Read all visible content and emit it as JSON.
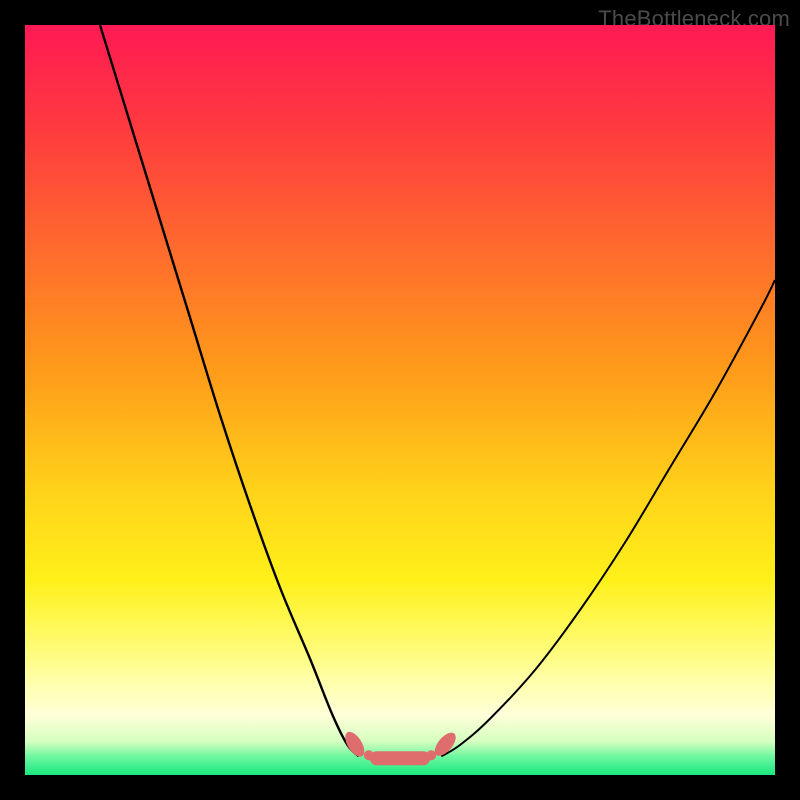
{
  "watermark": "TheBottleneck.com",
  "chart_data": {
    "type": "line",
    "title": "",
    "xlabel": "",
    "ylabel": "",
    "x_range": [
      0,
      100
    ],
    "y_range": [
      0,
      100
    ],
    "grid": false,
    "legend": false,
    "series": [
      {
        "name": "left-curve",
        "x": [
          10,
          14,
          18,
          22,
          26,
          30,
          34,
          38,
          41,
          43,
          44.5
        ],
        "y": [
          100,
          87,
          74,
          61,
          48,
          36,
          25,
          15.5,
          8,
          4,
          2.5
        ]
      },
      {
        "name": "right-curve",
        "x": [
          55.5,
          58,
          62,
          68,
          74,
          80,
          86,
          92,
          98,
          100
        ],
        "y": [
          2.5,
          4,
          7.5,
          14,
          22,
          31,
          41,
          51,
          62,
          66
        ]
      }
    ],
    "flat_segment": {
      "name": "valley-marker",
      "x_start": 44.5,
      "x_end": 55.5,
      "y": 2.5,
      "color": "#e06d6d"
    },
    "gradient_stops": [
      {
        "offset": 0.0,
        "color": "#ff1a54"
      },
      {
        "offset": 0.14,
        "color": "#ff3b3f"
      },
      {
        "offset": 0.3,
        "color": "#ff6b2d"
      },
      {
        "offset": 0.46,
        "color": "#ff9b1a"
      },
      {
        "offset": 0.62,
        "color": "#ffd21a"
      },
      {
        "offset": 0.74,
        "color": "#fff01a"
      },
      {
        "offset": 0.82,
        "color": "#fffb6a"
      },
      {
        "offset": 0.88,
        "color": "#ffffb0"
      },
      {
        "offset": 0.92,
        "color": "#ffffd8"
      },
      {
        "offset": 0.955,
        "color": "#d6ffc0"
      },
      {
        "offset": 0.975,
        "color": "#70f7a0"
      },
      {
        "offset": 1.0,
        "color": "#18e880"
      }
    ]
  }
}
